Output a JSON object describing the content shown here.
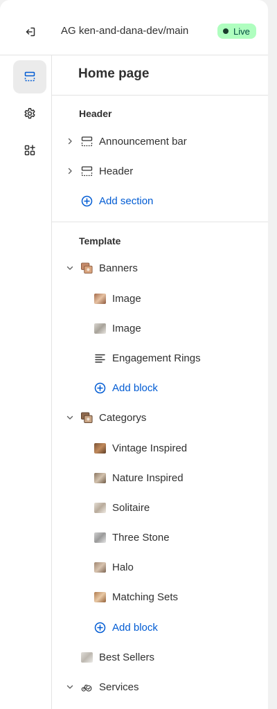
{
  "topbar": {
    "exit_icon": "exit-icon",
    "store_name": "AG ken-and-dana-dev/main",
    "status": "Live",
    "status_color": "#affebf"
  },
  "rail": {
    "items": [
      {
        "icon": "sections-icon",
        "active": true
      },
      {
        "icon": "gear-icon",
        "active": false
      },
      {
        "icon": "apps-icon",
        "active": false
      }
    ]
  },
  "panel": {
    "title": "Home page",
    "header_group": {
      "title": "Header",
      "sections": [
        "Announcement bar",
        "Header"
      ],
      "add_label": "Add section"
    },
    "template_group": {
      "title": "Template",
      "banners": {
        "label": "Banners",
        "blocks": [
          "Image",
          "Image",
          "Engagement Rings"
        ],
        "add_label": "Add block"
      },
      "categorys": {
        "label": "Categorys",
        "blocks": [
          "Vintage Inspired",
          "Nature Inspired",
          "Solitaire",
          "Three Stone",
          "Halo",
          "Matching Sets"
        ],
        "add_label": "Add block"
      },
      "best_sellers": "Best Sellers",
      "services": "Services"
    }
  },
  "colors": {
    "accent_blue": "#005bd3",
    "text": "#303030",
    "live_dot": "#1a3a2c"
  }
}
